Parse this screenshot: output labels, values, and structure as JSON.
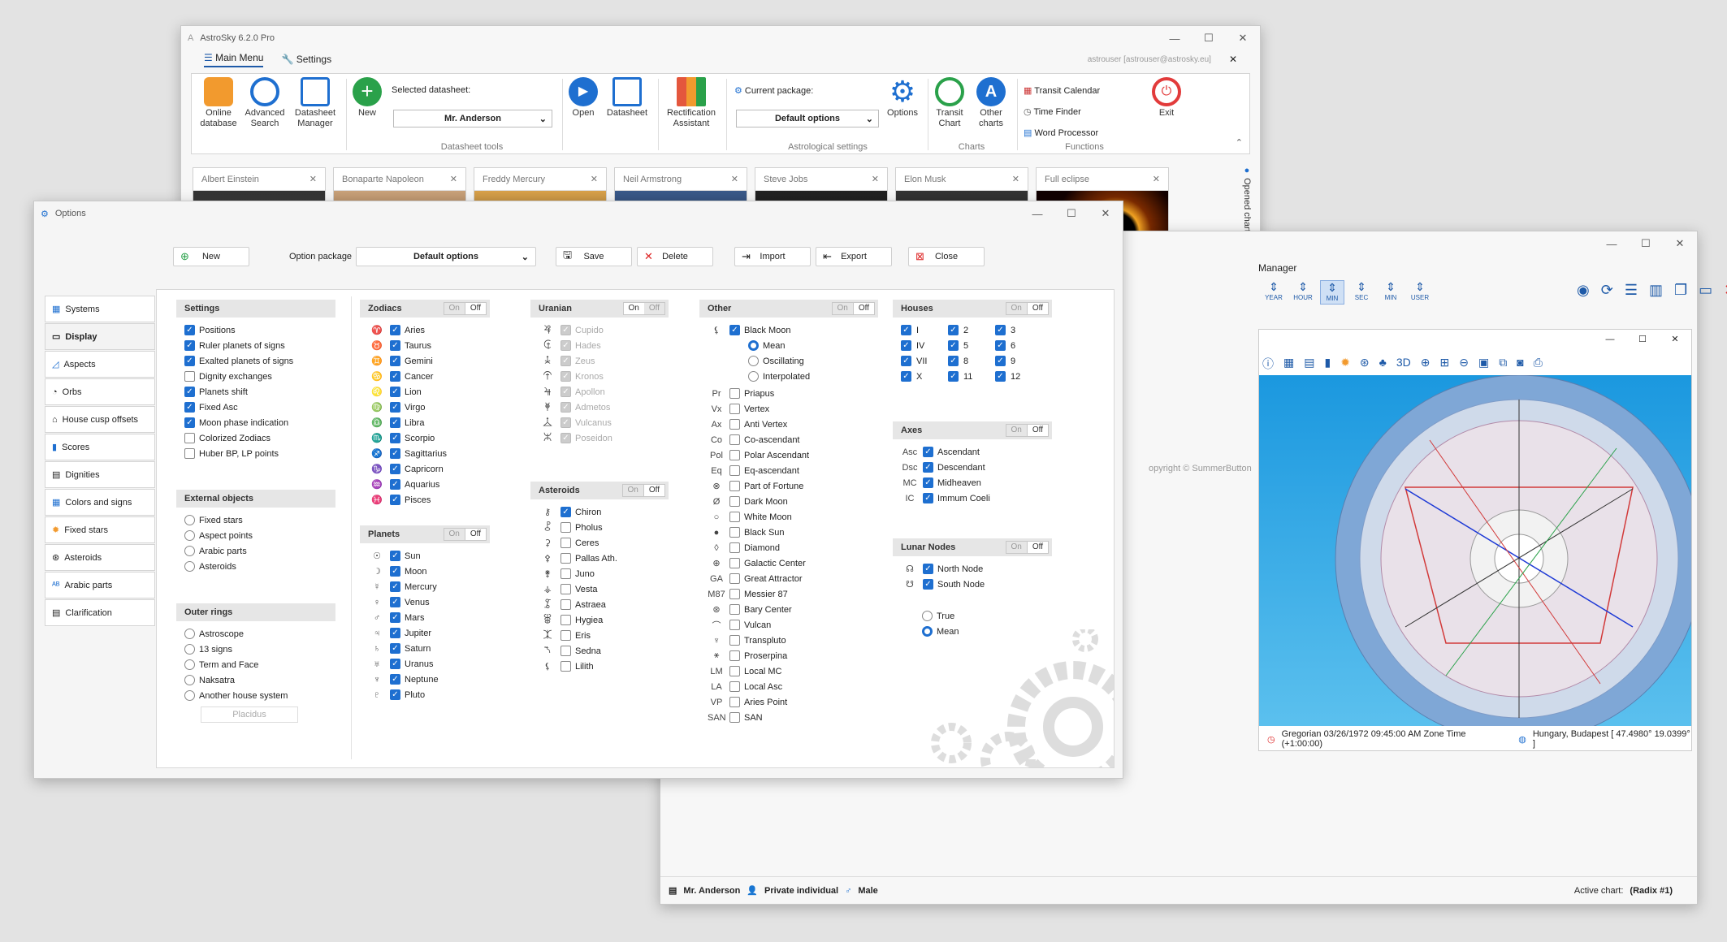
{
  "main_window": {
    "title": "AstroSky 6.2.0 Pro",
    "user": "astrouser [astrouser@astrosky.eu]",
    "menu_tabs": [
      "Main Menu",
      "Settings"
    ],
    "ribbon": {
      "online_db": "Online database",
      "adv_search": "Advanced Search",
      "ds_manager": "Datasheet Manager",
      "new": "New",
      "selected_ds_label": "Selected datasheet:",
      "selected_ds": "Mr. Anderson",
      "open": "Open",
      "datasheet": "Datasheet",
      "rect": "Rectification Assistant",
      "current_pkg_label": "Current package:",
      "current_pkg": "Default options",
      "options": "Options",
      "transit": "Transit Chart",
      "other": "Other charts",
      "transit_cal": "Transit Calendar",
      "time_finder": "Time Finder",
      "word_proc": "Word Processor",
      "exit": "Exit",
      "groups": {
        "ds_tools": "Datasheet tools",
        "astro": "Astrological settings",
        "charts": "Charts",
        "functions": "Functions"
      }
    },
    "chart_tabs": [
      "Albert Einstein",
      "Bonaparte Napoleon",
      "Freddy Mercury",
      "Neil Armstrong",
      "Steve Jobs",
      "Elon Musk",
      "Full eclipse"
    ],
    "opened_charts": "Opened charts"
  },
  "chart_window": {
    "title": "Manager",
    "toolbar": [
      "YEAR",
      "HOUR",
      "MIN",
      "SEC",
      "MIN",
      "USER"
    ],
    "copyright": "opyright © SummerButton",
    "footer": "Gregorian  03/26/1972 09:45:00 AM  Zone Time (+1:00:00)",
    "location": "Hungary, Budapest  [ 47.4980°  19.0399° ]",
    "status": {
      "name": "Mr. Anderson",
      "type": "Private individual",
      "gender": "Male",
      "active_label": "Active chart:",
      "active": "(Radix #1)"
    }
  },
  "options": {
    "title": "Options",
    "toolbar": {
      "new": "New",
      "pkg_label": "Option package",
      "pkg": "Default options",
      "save": "Save",
      "delete": "Delete",
      "import": "Import",
      "export": "Export",
      "close": "Close"
    },
    "sidebar": [
      "Systems",
      "Display",
      "Aspects",
      "Orbs",
      "House cusp offsets",
      "Scores",
      "Dignities",
      "Colors and signs",
      "Fixed stars",
      "Asteroids",
      "Arabic parts",
      "Clarification"
    ],
    "on": "On",
    "off": "Off",
    "settings": {
      "title": "Settings",
      "items": [
        "Positions",
        "Ruler planets of signs",
        "Exalted planets of signs",
        "Dignity exchanges",
        "Planets shift",
        "Fixed Asc",
        "Moon phase indication",
        "Colorized Zodiacs",
        "Huber BP, LP points"
      ]
    },
    "external": {
      "title": "External objects",
      "items": [
        "Fixed stars",
        "Aspect points",
        "Arabic parts",
        "Asteroids"
      ]
    },
    "outer": {
      "title": "Outer rings",
      "items": [
        "Astroscope",
        "13 signs",
        "Term and Face",
        "Naksatra",
        "Another house system"
      ],
      "system": "Placidus"
    },
    "zodiacs": {
      "title": "Zodiacs",
      "items": [
        "Aries",
        "Taurus",
        "Gemini",
        "Cancer",
        "Lion",
        "Virgo",
        "Libra",
        "Scorpio",
        "Sagittarius",
        "Capricorn",
        "Aquarius",
        "Pisces"
      ]
    },
    "planets": {
      "title": "Planets",
      "items": [
        "Sun",
        "Moon",
        "Mercury",
        "Venus",
        "Mars",
        "Jupiter",
        "Saturn",
        "Uranus",
        "Neptune",
        "Pluto"
      ]
    },
    "uranian": {
      "title": "Uranian",
      "items": [
        "Cupido",
        "Hades",
        "Zeus",
        "Kronos",
        "Apollon",
        "Admetos",
        "Vulcanus",
        "Poseidon"
      ]
    },
    "asteroids": {
      "title": "Asteroids",
      "items": [
        "Chiron",
        "Pholus",
        "Ceres",
        "Pallas Ath.",
        "Juno",
        "Vesta",
        "Astraea",
        "Hygiea",
        "Eris",
        "Sedna",
        "Lilith"
      ]
    },
    "other": {
      "title": "Other",
      "black_moon": "Black Moon",
      "modes": [
        "Mean",
        "Oscillating",
        "Interpolated"
      ],
      "items": [
        [
          "Pr",
          "Priapus"
        ],
        [
          "Vx",
          "Vertex"
        ],
        [
          "Ax",
          "Anti Vertex"
        ],
        [
          "Co",
          "Co-ascendant"
        ],
        [
          "Pol",
          "Polar Ascendant"
        ],
        [
          "Eq",
          "Eq-ascendant"
        ],
        [
          "⊗",
          "Part of Fortune"
        ],
        [
          "Ø",
          "Dark Moon"
        ],
        [
          "○",
          "White Moon"
        ],
        [
          "●",
          "Black Sun"
        ],
        [
          "◊",
          "Diamond"
        ],
        [
          "⊕",
          "Galactic Center"
        ],
        [
          "GA",
          "Great Attractor"
        ],
        [
          "M87",
          "Messier 87"
        ],
        [
          "⊛",
          "Bary Center"
        ],
        [
          "⌒",
          "Vulcan"
        ],
        [
          "♆",
          "Transpluto"
        ],
        [
          "⚹",
          "Proserpina"
        ],
        [
          "LM",
          "Local MC"
        ],
        [
          "LA",
          "Local Asc"
        ],
        [
          "VP",
          "Aries Point"
        ],
        [
          "SAN",
          "SAN"
        ]
      ]
    },
    "houses": {
      "title": "Houses",
      "items": [
        "I",
        "2",
        "3",
        "IV",
        "5",
        "6",
        "VII",
        "8",
        "9",
        "X",
        "11",
        "12"
      ]
    },
    "axes": {
      "title": "Axes",
      "items": [
        [
          "Asc",
          "Ascendant"
        ],
        [
          "Dsc",
          "Descendant"
        ],
        [
          "MC",
          "Midheaven"
        ],
        [
          "IC",
          "Immum Coeli"
        ]
      ]
    },
    "lunar": {
      "title": "Lunar Nodes",
      "items": [
        "North Node",
        "South Node"
      ],
      "modes": [
        "True",
        "Mean"
      ]
    }
  }
}
